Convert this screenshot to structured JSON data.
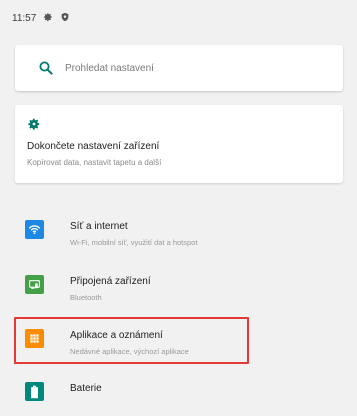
{
  "statusbar": {
    "time": "11:57"
  },
  "search": {
    "placeholder": "Prohledat nastavení"
  },
  "suggestion": {
    "title": "Dokončete nastavení zařízení",
    "subtitle": "Kopírovat data, nastavit tapetu a další"
  },
  "items": [
    {
      "title": "Síť a internet",
      "subtitle": "Wi-Fi, mobilní síť, využití dat a hotspot",
      "color": "#1e88e5",
      "icon": "wifi-icon"
    },
    {
      "title": "Připojená zařízení",
      "subtitle": "Bluetooth",
      "color": "#43a047",
      "icon": "devices-icon"
    },
    {
      "title": "Aplikace a oznámení",
      "subtitle": "Nedávné aplikace, výchozí aplikace",
      "color": "#fb8c00",
      "icon": "apps-grid-icon"
    },
    {
      "title": "Baterie",
      "subtitle": "",
      "color": "#00897b",
      "icon": "battery-icon"
    }
  ],
  "colors": {
    "accent": "#00796b",
    "highlight": "#e53935"
  }
}
